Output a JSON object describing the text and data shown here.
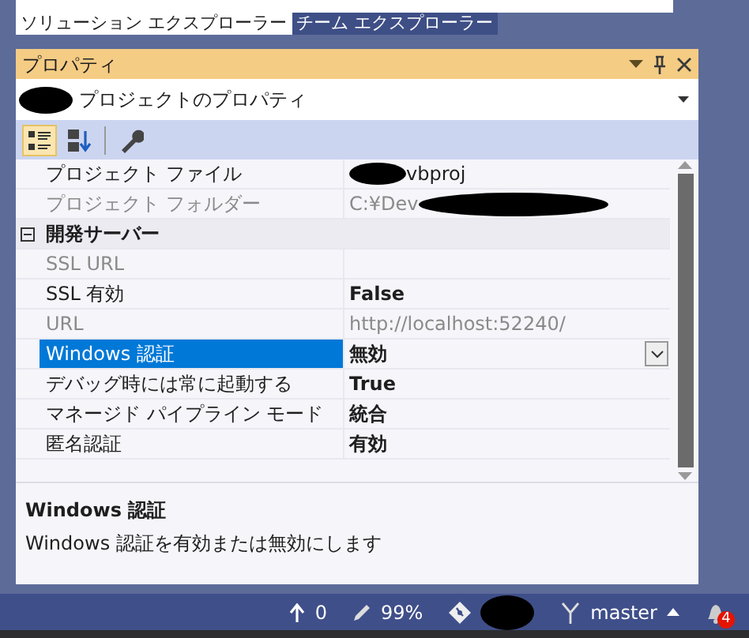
{
  "explorer_tabs": [
    {
      "label": "ソリューション エクスプローラー",
      "selected": true
    },
    {
      "label": "チーム エクスプローラー",
      "selected": false
    }
  ],
  "properties_panel": {
    "title": "プロパティ",
    "object_selector": {
      "redacted": true,
      "label": "プロジェクトのプロパティ"
    },
    "toolbar": [
      {
        "kind": "categorized",
        "selected": true
      },
      {
        "kind": "alphabetical",
        "selected": false
      },
      {
        "kind": "property_pages",
        "selected": false
      }
    ],
    "rows": [
      {
        "kind": "property",
        "name": "プロジェクト ファイル",
        "value": "vbproj",
        "redacted_before": true,
        "readonly": false,
        "bold": false,
        "selected": false
      },
      {
        "kind": "property",
        "name": "プロジェクト フォルダー",
        "value": "C:¥Dev",
        "redacted_after": true,
        "readonly": true,
        "bold": false,
        "selected": false
      },
      {
        "kind": "category",
        "name": "開発サーバー",
        "expanded": true
      },
      {
        "kind": "property",
        "name": "SSL URL",
        "value": "",
        "readonly": true,
        "selected": false
      },
      {
        "kind": "property",
        "name": "SSL 有効",
        "value": "False",
        "readonly": false,
        "bold": true,
        "selected": false
      },
      {
        "kind": "property",
        "name": "URL",
        "value": "http://localhost:52240/",
        "readonly": true,
        "bold": false,
        "selected": false
      },
      {
        "kind": "property",
        "name": "Windows 認証",
        "value": "無効",
        "readonly": false,
        "bold": true,
        "selected": true
      },
      {
        "kind": "property",
        "name": "デバッグ時には常に起動する",
        "value": "True",
        "readonly": false,
        "bold": true,
        "selected": false
      },
      {
        "kind": "property",
        "name": "マネージド パイプライン モード",
        "value": "統合",
        "readonly": false,
        "bold": true,
        "selected": false
      },
      {
        "kind": "property",
        "name": "匿名認証",
        "value": "有効",
        "readonly": false,
        "bold": true,
        "selected": false
      }
    ],
    "description": {
      "title": "Windows 認証",
      "text": "Windows 認証を有効または無効にします"
    }
  },
  "status_bar": [
    {
      "kind": "push",
      "text": "0"
    },
    {
      "kind": "changes",
      "text": "99%"
    },
    {
      "kind": "repository",
      "redacted": true
    },
    {
      "kind": "branch",
      "text": "master"
    },
    {
      "kind": "notifications",
      "badge": "4"
    }
  ]
}
